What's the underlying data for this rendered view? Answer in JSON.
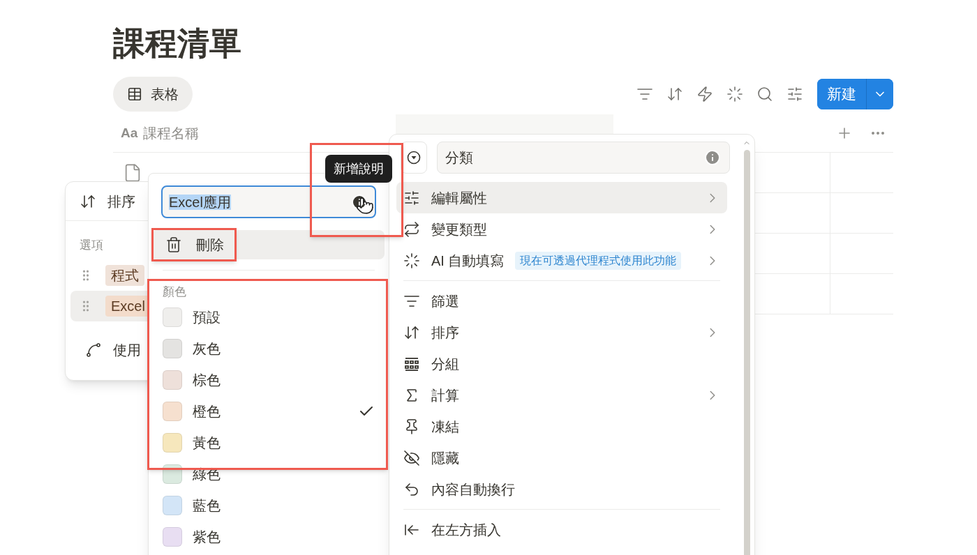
{
  "page": {
    "title": "課程清單"
  },
  "view_tab": {
    "label": "表格",
    "selected": true
  },
  "toolbar": {
    "new_button": "新建"
  },
  "table": {
    "name_column": {
      "icon_text": "Aa",
      "label": "課程名稱"
    }
  },
  "sort_panel": {
    "sort_label": "排序",
    "section_label": "選項",
    "options": [
      {
        "label": "程式",
        "color": "#f0e2d9",
        "selected": false
      },
      {
        "label": "Excel",
        "color": "#f3dccb",
        "selected": true
      }
    ],
    "footer_label": "使用"
  },
  "option_editor": {
    "name_value": "Excel應用",
    "delete_label": "刪除",
    "color_heading": "顏色",
    "colors": [
      {
        "label": "預設",
        "color": "#efeeec",
        "selected": false
      },
      {
        "label": "灰色",
        "color": "#e4e3e1",
        "selected": false
      },
      {
        "label": "棕色",
        "color": "#eee0da",
        "selected": false
      },
      {
        "label": "橙色",
        "color": "#f6e0cf",
        "selected": true
      },
      {
        "label": "黃色",
        "color": "#f6e7bc",
        "selected": false
      },
      {
        "label": "綠色",
        "color": "#dbeae0",
        "selected": false
      },
      {
        "label": "藍色",
        "color": "#d3e5f7",
        "selected": false
      },
      {
        "label": "紫色",
        "color": "#e8def2",
        "selected": false
      }
    ]
  },
  "tooltip": {
    "text": "新增說明"
  },
  "property_menu": {
    "name_value": "分類",
    "items": [
      {
        "kind": "item",
        "label": "編輯屬性",
        "submenu": true,
        "hovered": true
      },
      {
        "kind": "item",
        "label": "變更類型",
        "submenu": true,
        "hovered": false
      },
      {
        "kind": "item",
        "label": "AI 自動填寫",
        "badge": "現在可透過代理程式使用此功能",
        "submenu": true,
        "hovered": false
      },
      {
        "kind": "divider"
      },
      {
        "kind": "item",
        "label": "篩選",
        "submenu": false,
        "hovered": false
      },
      {
        "kind": "item",
        "label": "排序",
        "submenu": true,
        "hovered": false
      },
      {
        "kind": "item",
        "label": "分組",
        "submenu": false,
        "hovered": false
      },
      {
        "kind": "item",
        "label": "計算",
        "submenu": true,
        "hovered": false
      },
      {
        "kind": "item",
        "label": "凍結",
        "submenu": false,
        "hovered": false
      },
      {
        "kind": "item",
        "label": "隱藏",
        "submenu": false,
        "hovered": false
      },
      {
        "kind": "item",
        "label": "內容自動換行",
        "submenu": false,
        "hovered": false
      },
      {
        "kind": "divider"
      },
      {
        "kind": "item",
        "label": "在左方插入",
        "submenu": false,
        "hovered": false
      }
    ]
  }
}
